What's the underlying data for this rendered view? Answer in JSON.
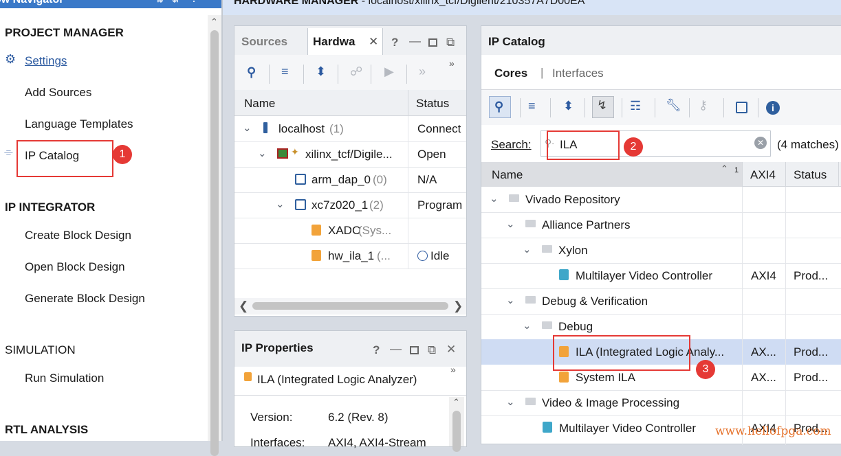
{
  "flow_navigator": {
    "title": "ow Navigator",
    "project_manager": "PROJECT MANAGER",
    "settings": "Settings",
    "add_sources": "Add Sources",
    "language_templates": "Language Templates",
    "ip_catalog": "IP Catalog",
    "ip_integrator": "IP INTEGRATOR",
    "create_block_design": "Create Block Design",
    "open_block_design": "Open Block Design",
    "generate_block_design": "Generate Block Design",
    "simulation": "SIMULATION",
    "run_simulation": "Run Simulation",
    "rtl_analysis": "RTL ANALYSIS"
  },
  "banner": {
    "title": "HARDWARE MANAGER",
    "path": " - localhost/xilinx_tcf/Digilent/210357A7D00EA"
  },
  "hardware_panel": {
    "tabs": [
      "Sources",
      "Hardwa"
    ],
    "columns": [
      "Name",
      "Status"
    ],
    "rows": [
      {
        "name": "localhost",
        "count": " (1)",
        "status": "Connect"
      },
      {
        "name": "xilinx_tcf/Digile...",
        "count": "",
        "status": "Open"
      },
      {
        "name": "arm_dap_0",
        "count": " (0)",
        "status": "N/A"
      },
      {
        "name": "xc7z020_1",
        "count": " (2)",
        "status": "Program"
      },
      {
        "name": "XADC",
        "count": " (Sys...",
        "status": ""
      },
      {
        "name": "hw_ila_1",
        "count": " (...",
        "status": "Idle"
      }
    ]
  },
  "ip_properties": {
    "title": "IP Properties",
    "name": "ILA (Integrated Logic Analyzer)",
    "version_label": "Version:",
    "version_value": "6.2 (Rev. 8)",
    "interfaces_label": "Interfaces:",
    "interfaces_value": "AXI4, AXI4-Stream"
  },
  "ip_catalog": {
    "title": "IP Catalog",
    "tabs": [
      "Cores",
      "Interfaces"
    ],
    "search_label": "Search:",
    "search_value": "ILA",
    "matches": "(4 matches)",
    "columns": [
      "Name",
      "AXI4",
      "Status"
    ],
    "sort_indicator": "1",
    "rows": [
      {
        "name": "Vivado Repository",
        "axi": "",
        "status": ""
      },
      {
        "name": "Alliance Partners",
        "axi": "",
        "status": ""
      },
      {
        "name": "Xylon",
        "axi": "",
        "status": ""
      },
      {
        "name": "Multilayer Video Controller",
        "axi": "AXI4",
        "status": "Prod..."
      },
      {
        "name": "Debug & Verification",
        "axi": "",
        "status": ""
      },
      {
        "name": "Debug",
        "axi": "",
        "status": ""
      },
      {
        "name": "ILA (Integrated Logic Analy...",
        "axi": "AX...",
        "status": "Prod..."
      },
      {
        "name": "System ILA",
        "axi": "AX...",
        "status": "Prod..."
      },
      {
        "name": "Video & Image Processing",
        "axi": "",
        "status": ""
      },
      {
        "name": "Multilayer Video Controller",
        "axi": "AXI4",
        "status": "Prod..."
      }
    ]
  },
  "annotations": [
    "1",
    "2",
    "3"
  ],
  "watermark": "www.hellofpga.com"
}
